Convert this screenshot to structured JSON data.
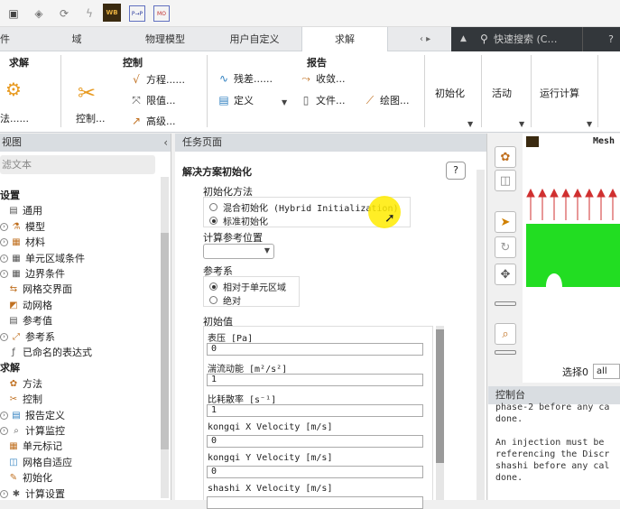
{
  "quick_access": {
    "icons": [
      "file-icon",
      "cube-icon",
      "refresh-icon",
      "lightning-icon",
      "workbench-icon",
      "parametric-icon",
      "mosaic-icon"
    ],
    "wb_label": "WB",
    "pp_label": "P→P",
    "mo_label": "MO"
  },
  "tabs": [
    {
      "label": "件"
    },
    {
      "label": "域"
    },
    {
      "label": "物理模型"
    },
    {
      "label": "用户自定义"
    },
    {
      "label": "求解"
    }
  ],
  "tab_nav": "‹ ▸",
  "search": {
    "placeholder": "快速搜索 (C…"
  },
  "ribbon": {
    "solve_group": {
      "title": "求解",
      "method_label": "法......"
    },
    "control_group": {
      "title": "控制",
      "big_label": "控制...",
      "equations": "方程......",
      "limits": "限值...",
      "advanced": "高级..."
    },
    "report_group": {
      "title": "报告",
      "residuals": "残差......",
      "convergence": "收敛...",
      "definitions": "定义",
      "files": "文件...",
      "plots": "绘图..."
    },
    "initialization": "初始化",
    "activities": "活动",
    "run_calculation": "运行计算"
  },
  "tree": {
    "header": "视图",
    "filter_placeholder": "滤文本",
    "items": [
      {
        "label": "设置",
        "level": 0,
        "icon": ""
      },
      {
        "label": "通用",
        "level": 1,
        "icon": "general-icon"
      },
      {
        "label": "模型",
        "level": 1,
        "icon": "models-icon",
        "toggle": true
      },
      {
        "label": "材料",
        "level": 1,
        "icon": "materials-icon",
        "toggle": true
      },
      {
        "label": "单元区域条件",
        "level": 1,
        "icon": "cell-zone-icon",
        "toggle": true
      },
      {
        "label": "边界条件",
        "level": 1,
        "icon": "boundary-icon",
        "toggle": true
      },
      {
        "label": "网格交界面",
        "level": 1,
        "icon": "mesh-interface-icon"
      },
      {
        "label": "动网格",
        "level": 1,
        "icon": "dynamic-mesh-icon"
      },
      {
        "label": "参考值",
        "level": 1,
        "icon": "reference-values-icon"
      },
      {
        "label": "参考系",
        "level": 1,
        "icon": "reference-frame-icon",
        "toggle": true
      },
      {
        "label": "已命名的表达式",
        "level": 1,
        "icon": "named-expression-icon"
      },
      {
        "label": "求解",
        "level": 0,
        "icon": ""
      },
      {
        "label": "方法",
        "level": 1,
        "icon": "methods-icon"
      },
      {
        "label": "控制",
        "level": 1,
        "icon": "controls-icon"
      },
      {
        "label": "报告定义",
        "level": 1,
        "icon": "report-def-icon",
        "toggle": true
      },
      {
        "label": "计算监控",
        "level": 1,
        "icon": "monitors-icon",
        "toggle": true
      },
      {
        "label": "单元标记",
        "level": 1,
        "icon": "cell-register-icon"
      },
      {
        "label": "网格自适应",
        "level": 1,
        "icon": "adaption-icon"
      },
      {
        "label": "初始化",
        "level": 1,
        "icon": "initialization-icon"
      },
      {
        "label": "计算设置",
        "level": 1,
        "icon": "calc-activities-icon",
        "toggle": true
      }
    ]
  },
  "task": {
    "header": "任务页面",
    "title": "解决方案初始化",
    "help": "?",
    "method_label": "初始化方法",
    "method_hybrid": "混合初始化 (Hybrid Initialization)",
    "method_standard": "标准初始化",
    "compute_from": "计算参考位置",
    "ref_frame": "参考系",
    "ref_relative": "相对于单元区域",
    "ref_absolute": "绝对",
    "init_values": "初始值",
    "fields": [
      {
        "label": "表压 [Pa]",
        "value": "0"
      },
      {
        "label": "湍流动能 [m²/s²]",
        "value": "1"
      },
      {
        "label": "比耗散率 [s⁻¹]",
        "value": "1"
      },
      {
        "label": "kongqi X Velocity [m/s]",
        "value": "0"
      },
      {
        "label": "kongqi Y Velocity [m/s]",
        "value": "0"
      },
      {
        "label": "shashi X Velocity [m/s]",
        "value": ""
      }
    ]
  },
  "graphics": {
    "title": "Mesh",
    "select_label": "选择0",
    "select_value": "all"
  },
  "console": {
    "header": "控制台",
    "lines": [
      "phase-2 before any ca",
      "done.",
      "",
      "An injection must be",
      "referencing the Discr",
      "shashi before any cal",
      "done."
    ]
  },
  "colors": {
    "tab_search_bg": "#33373b",
    "mesh_green": "#22dd22",
    "arrow_red": "#d03030"
  }
}
